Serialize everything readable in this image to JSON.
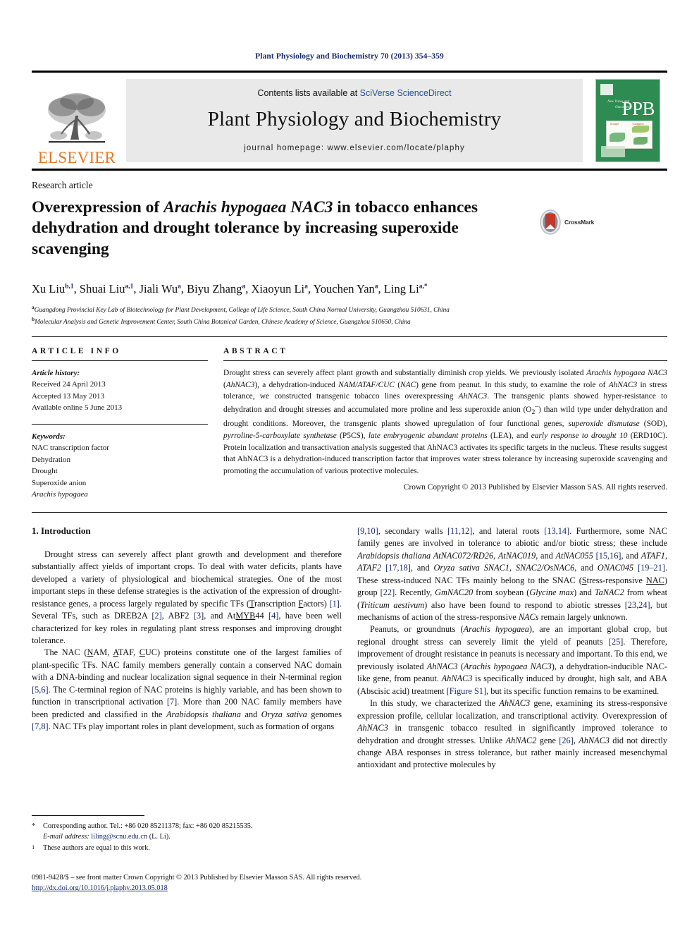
{
  "running_head": "Plant Physiology and Biochemistry 70 (2013) 354–359",
  "masthead": {
    "publisher_logo_text": "ELSEVIER",
    "contents_prefix": "Contents lists available at ",
    "contents_link": "SciVerse ScienceDirect",
    "journal_title": "Plant Physiology and Biochemistry",
    "homepage": "journal homepage: www.elsevier.com/locate/plaphy",
    "cover": {
      "abbrev": "PPB",
      "side_text": "New Vistas and Outcomes"
    }
  },
  "article": {
    "kind": "Research article",
    "title_part1": "Overexpression of ",
    "title_italic1": "Arachis hypogaea NAC3",
    "title_part2": " in tobacco enhances dehydration and drought tolerance by increasing superoxide scavenging",
    "crossmark_label": "CrossMark",
    "authors": [
      {
        "name": "Xu Liu",
        "sup": "b,1"
      },
      {
        "name": "Shuai Liu",
        "sup": "a,1"
      },
      {
        "name": "Jiali Wu",
        "sup": "a"
      },
      {
        "name": "Biyu Zhang",
        "sup": "a"
      },
      {
        "name": "Xiaoyun Li",
        "sup": "a"
      },
      {
        "name": "Youchen Yan",
        "sup": "a"
      },
      {
        "name": "Ling Li",
        "sup": "a,*"
      }
    ],
    "affiliations": [
      {
        "mark": "a",
        "text": "Guangdong Provincial Key Lab of Biotechnology for Plant Development, College of Life Science, South China Normal University, Guangzhou 510631, China"
      },
      {
        "mark": "b",
        "text": "Molecular Analysis and Genetic Improvement Center, South China Botanical Garden, Chinese Academy of Science, Guangzhou 510650, China"
      }
    ]
  },
  "article_info": {
    "heading": "ARTICLE INFO",
    "history_label": "Article history:",
    "history": [
      "Received 24 April 2013",
      "Accepted 13 May 2013",
      "Available online 5 June 2013"
    ],
    "keywords_label": "Keywords:",
    "keywords": [
      "NAC transcription factor",
      "Dehydration",
      "Drought",
      "Superoxide anion",
      "Arachis hypogaea"
    ]
  },
  "abstract": {
    "heading": "ABSTRACT",
    "copyright": "Crown Copyright © 2013 Published by Elsevier Masson SAS. All rights reserved."
  },
  "body": {
    "section1_heading": "1. Introduction",
    "left_paragraphs": [
      "Drought stress can severely affect plant growth and development and therefore substantially affect yields of important crops. To deal with water deficits, plants have developed a variety of physiological and biochemical strategies. One of the most important steps in these defense strategies is the activation of the expression of drought-resistance genes, a process largely regulated by specific TFs (Transcription Factors) [1]. Several TFs, such as DREB2A [2], ABF2 [3], and AtMYB44 [4], have been well characterized for key roles in regulating plant stress responses and improving drought tolerance.",
      "The NAC (NAM, ATAF, CUC) proteins constitute one of the largest families of plant-specific TFs. NAC family members generally contain a conserved NAC domain with a DNA-binding and nuclear localization signal sequence in their N-terminal region [5,6]. The C-terminal region of NAC proteins is highly variable, and has been shown to function in transcriptional activation [7]. More than 200 NAC family members have been predicted and classified in the Arabidopsis thaliana and Oryza sativa genomes [7,8]. NAC TFs play important roles in plant development, such as formation of organs"
    ],
    "right_paragraphs": [
      "[9,10], secondary walls [11,12], and lateral roots [13,14]. Furthermore, some NAC family genes are involved in tolerance to abiotic and/or biotic stress; these include Arabidopsis thaliana AtNAC072/RD26, AtNAC019, and AtNAC055 [15,16], and ATAF1, ATAF2 [17,18], and Oryza sativa SNAC1, SNAC2/OsNAC6, and ONAC045 [19–21]. These stress-induced NAC TFs mainly belong to the SNAC (Stress-responsive NAC) group [22]. Recently, GmNAC20 from soybean (Glycine max) and TaNAC2 from wheat (Triticum aestivum) also have been found to respond to abiotic stresses [23,24], but mechanisms of action of the stress-responsive NACs remain largely unknown.",
      "Peanuts, or groundnuts (Arachis hypogaea), are an important global crop, but regional drought stress can severely limit the yield of peanuts [25]. Therefore, improvement of drought resistance in peanuts is necessary and important. To this end, we previously isolated AhNAC3 (Arachis hypogaea NAC3), a dehydration-inducible NAC-like gene, from peanut. AhNAC3 is specifically induced by drought, high salt, and ABA (Abscisic acid) treatment [Figure S1], but its specific function remains to be examined.",
      "In this study, we characterized the AhNAC3 gene, examining its stress-responsive expression profile, cellular localization, and transcriptional activity. Overexpression of AhNAC3 in transgenic tobacco resulted in significantly improved tolerance to dehydration and drought stresses. Unlike AhNAC2 gene [26], AhNAC3 did not directly change ABA responses in stress tolerance, but rather mainly increased mesenchymal antioxidant and protective molecules by"
    ]
  },
  "footnotes": {
    "corresponding": "Corresponding author. Tel.: +86 020 85211378; fax: +86 020 85215535.",
    "email_label": "E-mail address:",
    "email": "liling@scnu.edu.cn",
    "email_suffix": "(L. Li).",
    "equal_contrib": "These authors are equal to this work."
  },
  "imprint": {
    "line1": "0981-9428/$ – see front matter Crown Copyright © 2013 Published by Elsevier Masson SAS. All rights reserved.",
    "doi": "http://dx.doi.org/10.1016/j.plaphy.2013.05.018"
  },
  "colors": {
    "link_blue": "#1b2a6b",
    "sciencedirect_blue": "#2b4ea2",
    "elsevier_orange": "#e87722",
    "cover_green": "#2e8b51",
    "crossmark_red": "#c0392b"
  }
}
